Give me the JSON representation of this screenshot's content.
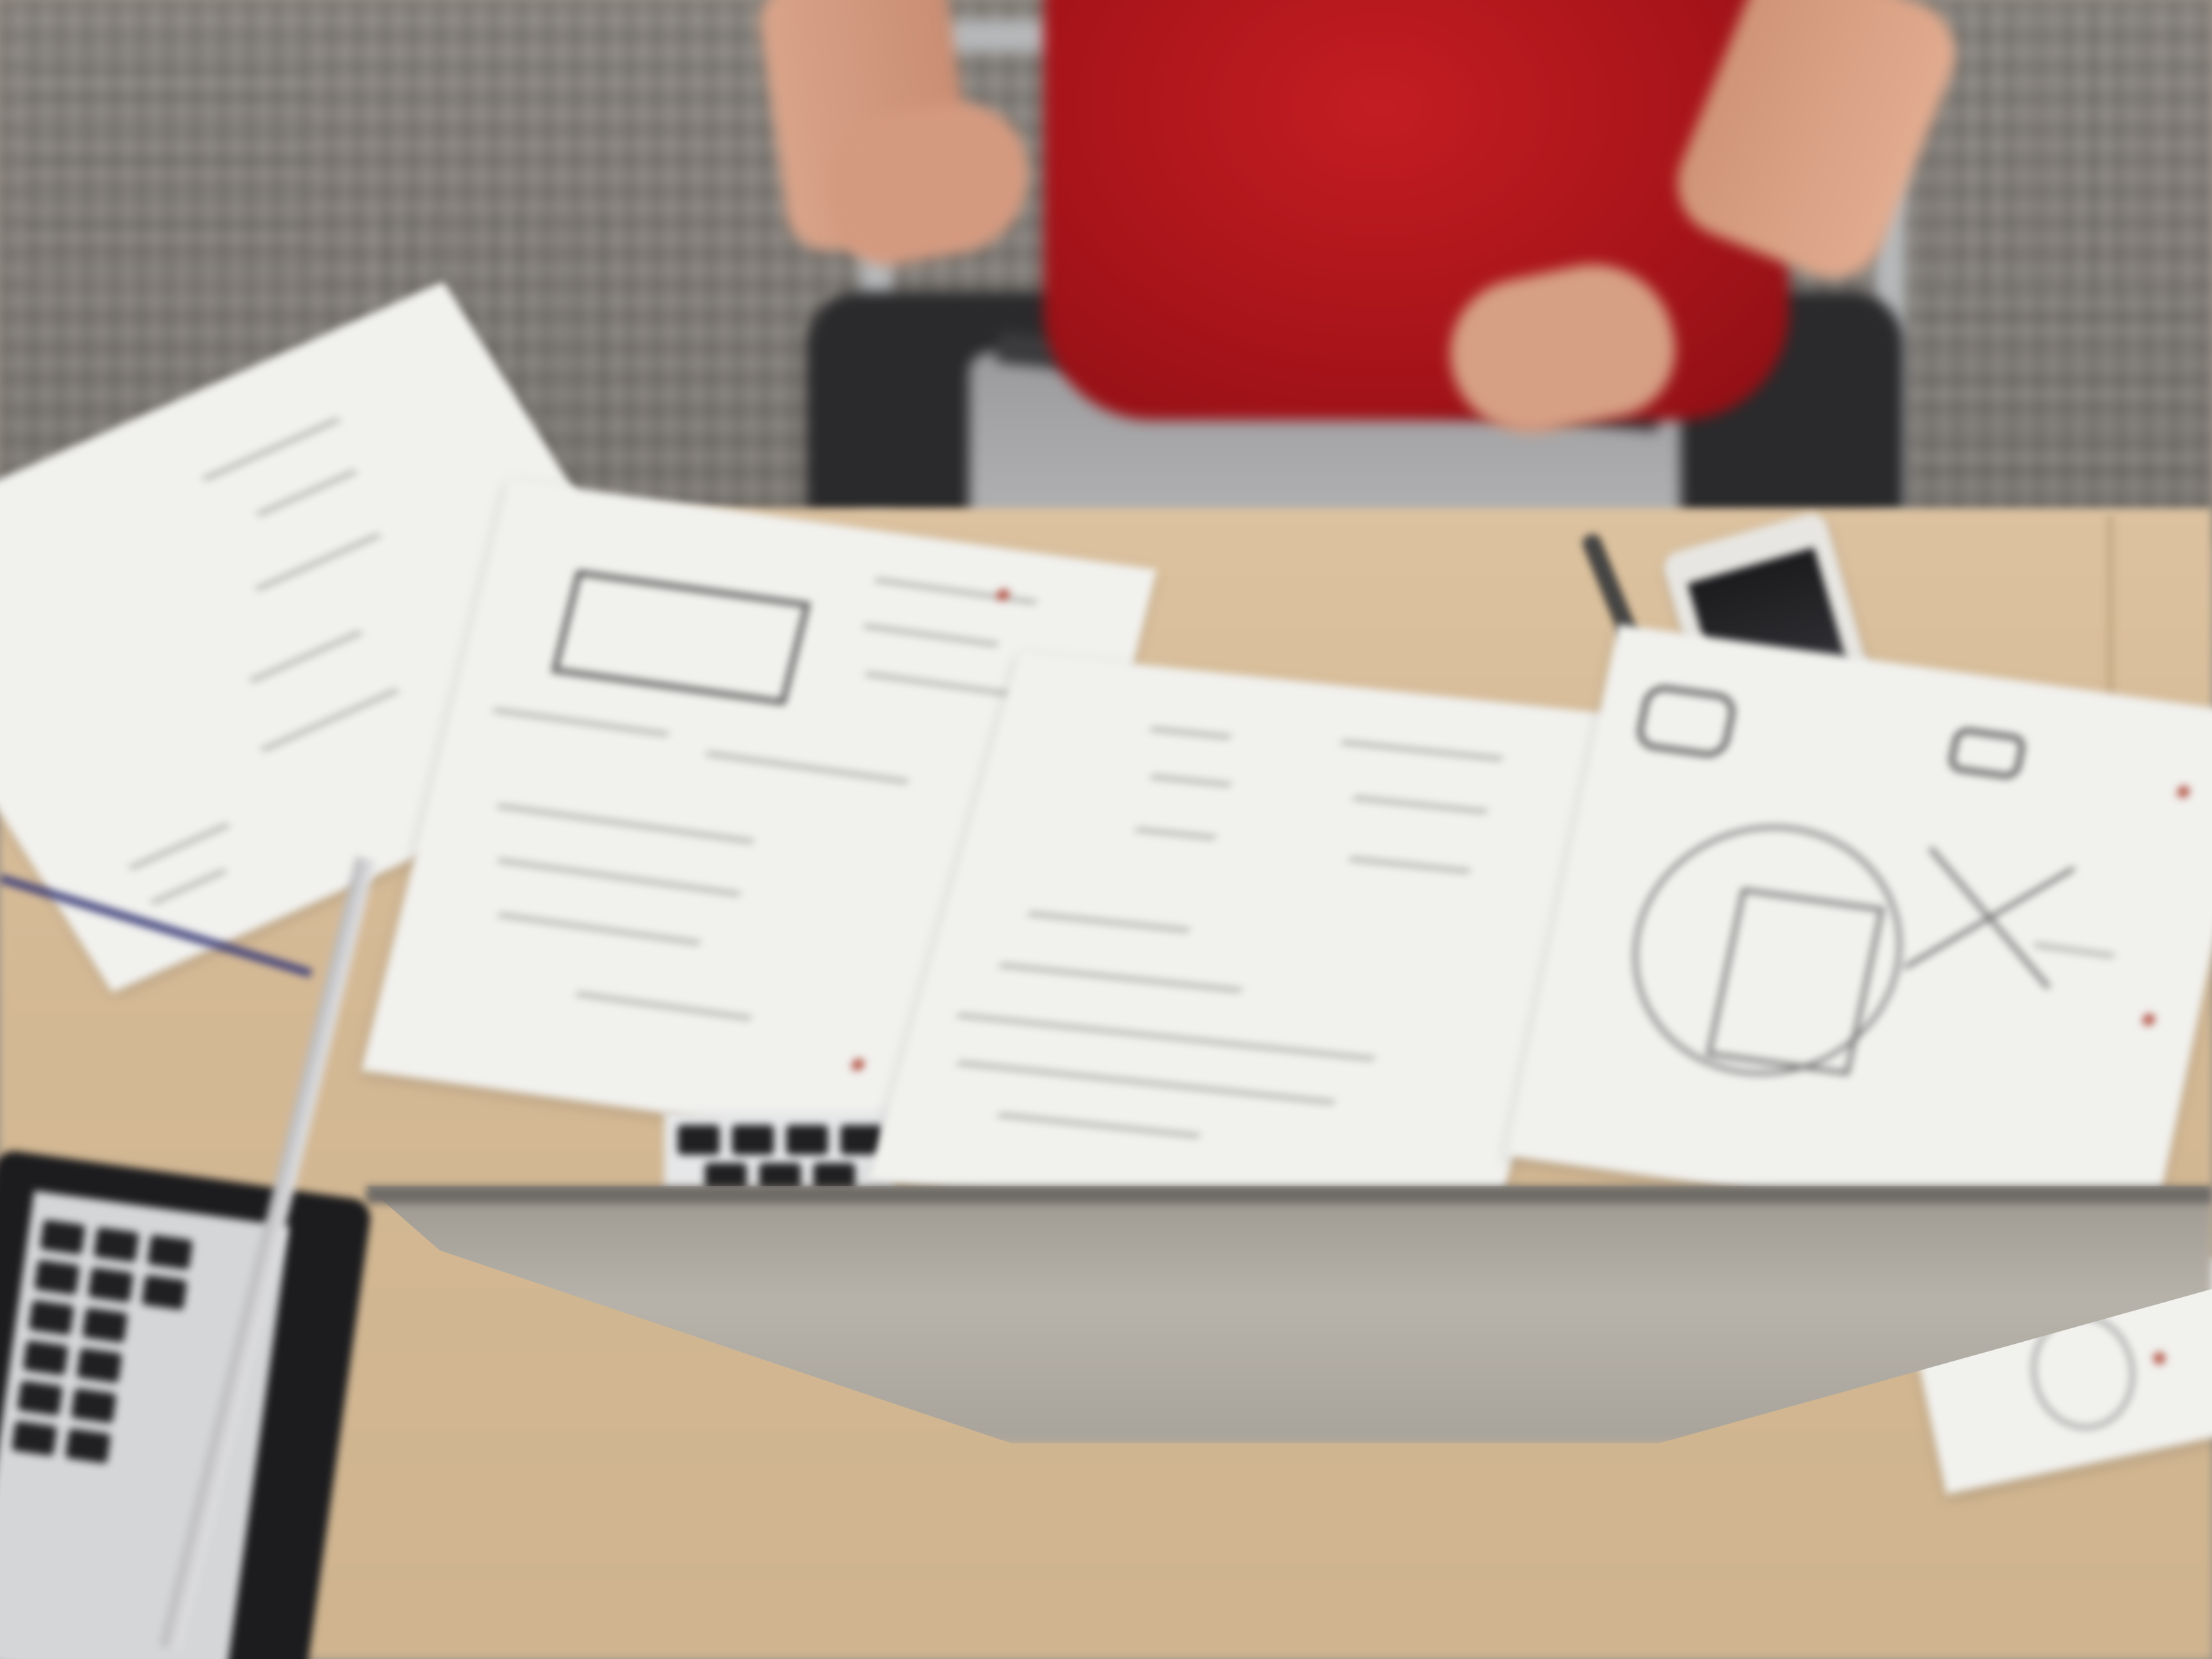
{
  "scene": {
    "description_tags": [
      "desk",
      "notebooks",
      "laptop",
      "person",
      "phone",
      "pen",
      "carpet",
      "chair"
    ],
    "colors": {
      "shirt": "#b3181d",
      "table": "#d6bc98",
      "carpet": "#85807a",
      "paper": "#f1f1ee",
      "laptop_lid": "#aba69d"
    }
  }
}
